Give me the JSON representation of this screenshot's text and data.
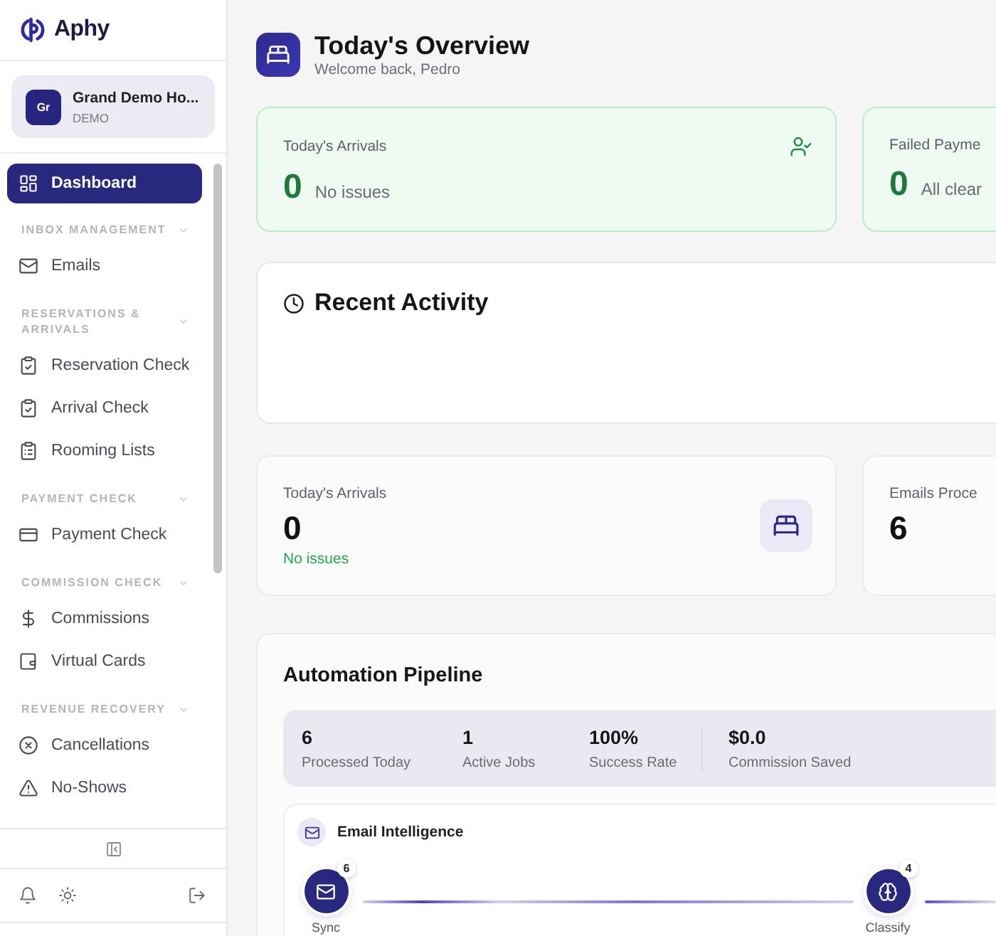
{
  "sidebar": {
    "logo": "Aphy",
    "property": {
      "initials": "Gr",
      "name": "Grand Demo Ho...",
      "plan": "DEMO"
    },
    "home": {
      "label": "Dashboard",
      "selected": true
    },
    "sections": [
      {
        "title": "INBOX MANAGEMENT",
        "expanded": true,
        "items": [
          {
            "label": "Emails",
            "selected": false
          }
        ]
      },
      {
        "title": "RESERVATIONS & ARRIVALS",
        "expanded": true,
        "items": [
          {
            "label": "Reservation Check",
            "selected": false
          },
          {
            "label": "Arrival Check",
            "selected": false
          },
          {
            "label": "Rooming Lists",
            "selected": false
          }
        ]
      },
      {
        "title": "PAYMENT CHECK",
        "expanded": true,
        "items": [
          {
            "label": "Payment Check",
            "selected": false
          }
        ]
      },
      {
        "title": "COMMISSION CHECK",
        "expanded": true,
        "items": [
          {
            "label": "Commissions",
            "selected": false
          },
          {
            "label": "Virtual Cards",
            "selected": false
          }
        ]
      },
      {
        "title": "REVENUE RECOVERY",
        "expanded": true,
        "items": [
          {
            "label": "Cancellations",
            "selected": false
          },
          {
            "label": "No-Shows",
            "selected": false
          }
        ]
      }
    ]
  },
  "header": {
    "title": "Today's Overview",
    "subtitle": "Welcome back, Pedro"
  },
  "alerts": [
    {
      "label": "Today's Arrivals",
      "value": "0",
      "note": "No issues"
    },
    {
      "label": "Failed Payme",
      "value": "0",
      "note": "All clear"
    }
  ],
  "recent_activity": {
    "title": "Recent Activity"
  },
  "stats": [
    {
      "label": "Today's Arrivals",
      "value": "0",
      "note": "No issues"
    },
    {
      "label": "Emails Proce",
      "value": "6"
    }
  ],
  "pipeline": {
    "title": "Automation Pipeline",
    "summary": [
      {
        "value": "6",
        "label": "Processed Today"
      },
      {
        "value": "1",
        "label": "Active Jobs"
      },
      {
        "value": "100%",
        "label": "Success Rate"
      },
      {
        "value": "$0.0",
        "label": "Commission Saved"
      }
    ],
    "flow": {
      "title": "Email Intelligence",
      "steps": [
        {
          "label": "Sync",
          "count": "6"
        },
        {
          "label": "Classify",
          "count": "4"
        }
      ]
    }
  }
}
